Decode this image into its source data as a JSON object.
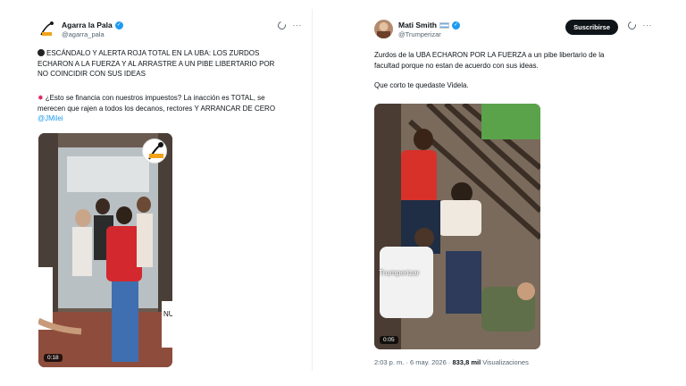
{
  "tweet1": {
    "author": {
      "name": "Agarra la Pala",
      "handle": "@agarra_pala"
    },
    "lines": [
      "ESCÁNDALO Y ALERTA ROJA TOTAL EN LA UBA: LOS ZURDOS",
      "ECHARON A LA FUERZA Y AL ARRASTRE A UN PIBE LIBERTARIO POR",
      "NO COINCIDIR CON SUS IDEAS",
      "¿Esto se financia con nuestros impuestos? La inacción es TOTAL, se",
      "merecen que rajen a todos los decanos, rectores Y ARRANCAR DE CERO"
    ],
    "mention": "@JMilei",
    "video": {
      "duration": "0:18",
      "badge_text": "AGARRA LA PALA",
      "sign_text": "NUL"
    }
  },
  "tweet2": {
    "author": {
      "name": "Mati Smith",
      "handle": "@Trumperizar"
    },
    "subscribe_label": "Suscribirse",
    "lines": [
      "Zurdos de la UBA ECHARON POR LA FUERZA a un pibe libertario de la",
      "facultad porque no estan de acuerdo con sus ideas.",
      "Que corto te quedaste Videla."
    ],
    "video": {
      "duration": "0:05",
      "watermark": "Trumperizar"
    },
    "meta": {
      "time": "2:03 p. m.",
      "date": "6 may. 2026",
      "views": "833,8 mil",
      "views_label": "Visualizaciones",
      "sep": "·"
    }
  },
  "icons": [
    "verified-icon",
    "grok-icon",
    "more-icon",
    "argentina-flag-icon",
    "bomb-icon",
    "collision-icon"
  ],
  "colors": {
    "accent": "#1d9bf0",
    "text": "#0f1419",
    "muted": "#536471",
    "button": "#0f1419"
  }
}
